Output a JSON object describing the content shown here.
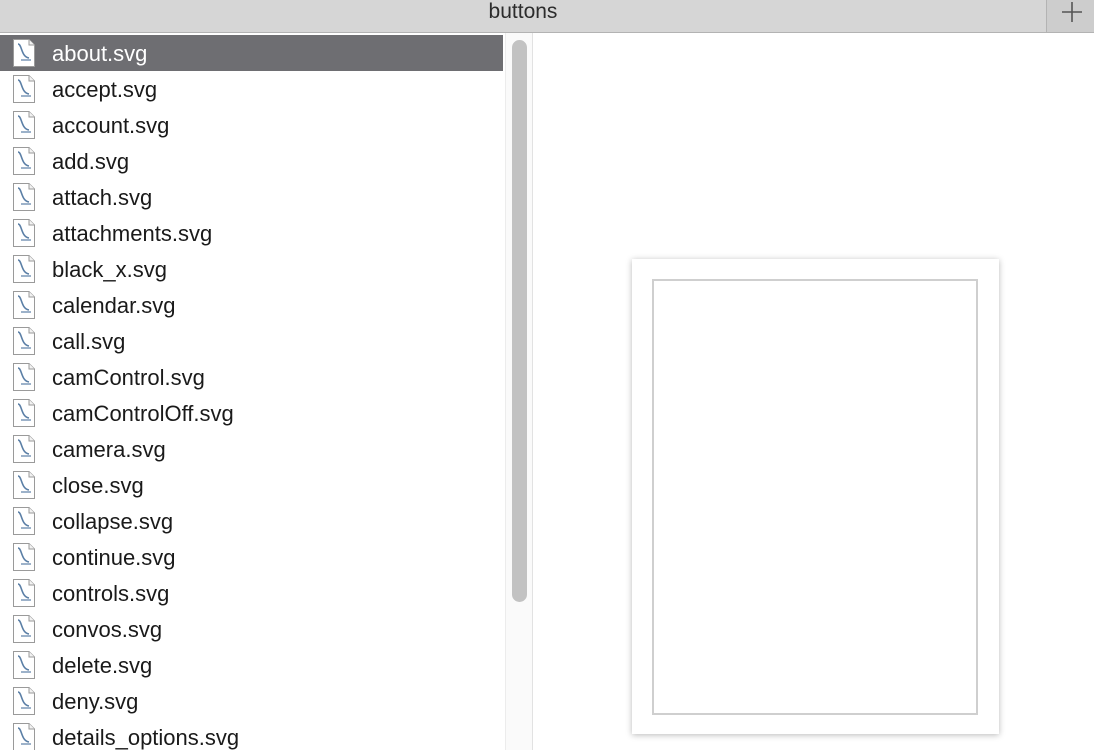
{
  "window": {
    "tab_title": "buttons",
    "new_tab_icon": "plus-icon"
  },
  "file_list": {
    "file_icon": "svg-document-icon",
    "selected_index": 0,
    "items": [
      "about.svg",
      "accept.svg",
      "account.svg",
      "add.svg",
      "attach.svg",
      "attachments.svg",
      "black_x.svg",
      "calendar.svg",
      "call.svg",
      "camControl.svg",
      "camControlOff.svg",
      "camera.svg",
      "close.svg",
      "collapse.svg",
      "continue.svg",
      "controls.svg",
      "convos.svg",
      "delete.svg",
      "deny.svg",
      "details_options.svg"
    ]
  },
  "colors": {
    "selection": "#6e6e72",
    "tab_bar": "#d6d6d6",
    "icon_accent": "#5b7fa6"
  }
}
